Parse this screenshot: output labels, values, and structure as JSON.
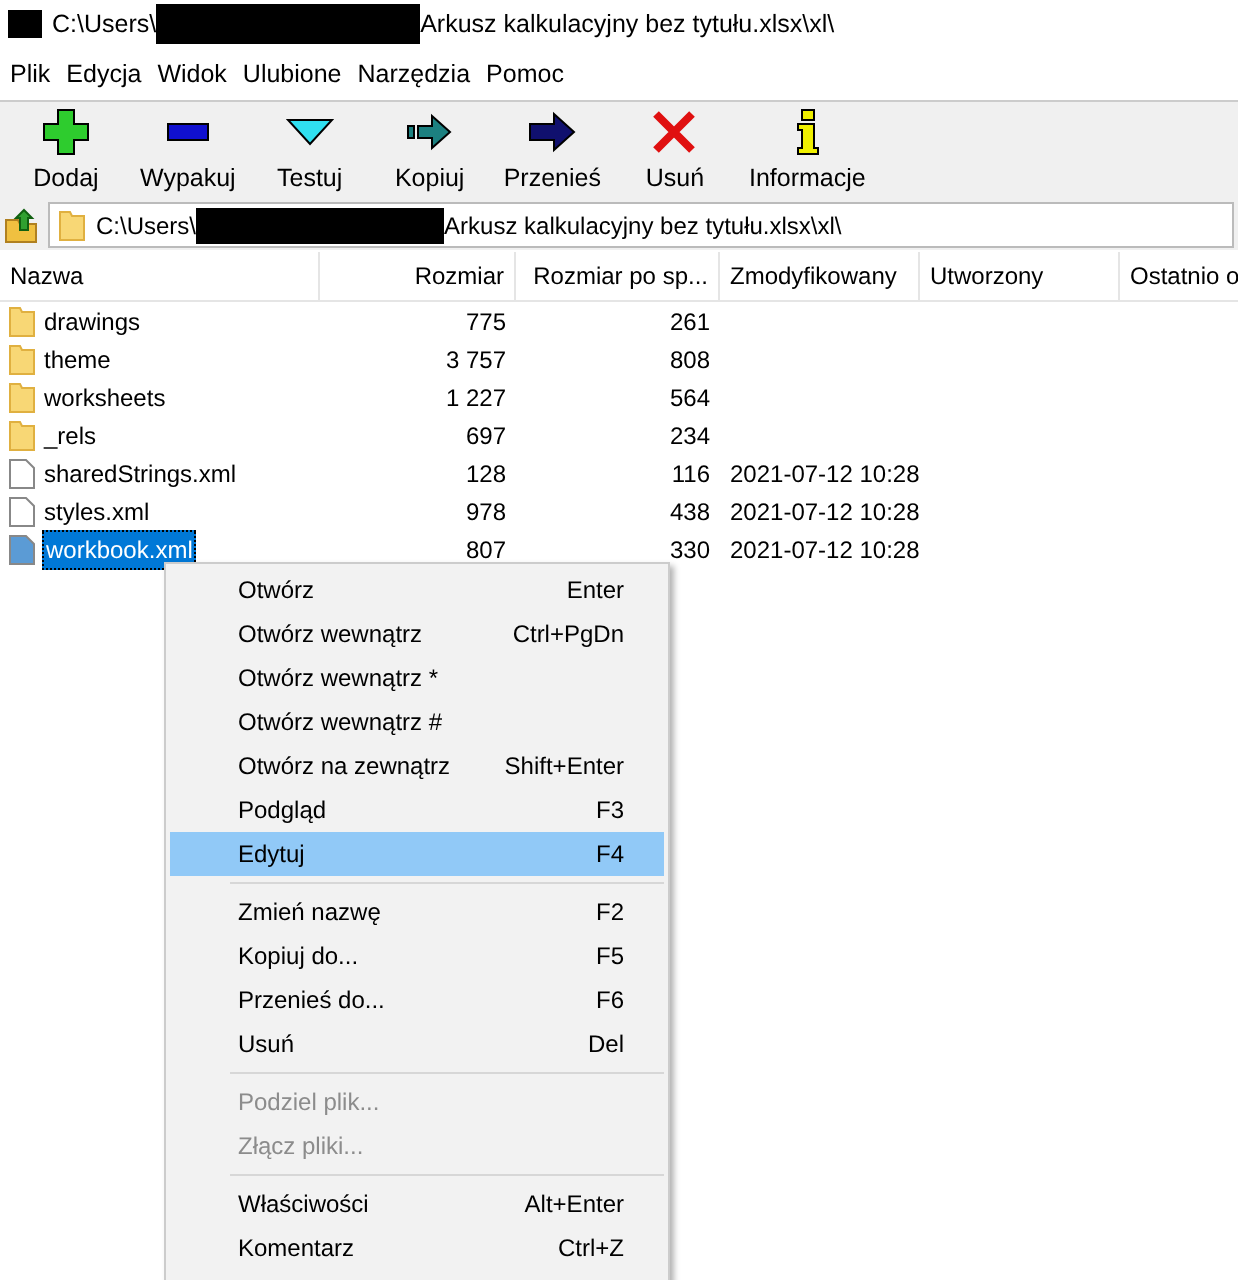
{
  "window": {
    "title_start": "C:\\Users\\",
    "title_end": "Arkusz kalkulacyjny bez tytułu.xlsx\\xl\\"
  },
  "menu_bar": [
    "Plik",
    "Edycja",
    "Widok",
    "Ulubione",
    "Narzędzia",
    "Pomoc"
  ],
  "toolbar": [
    {
      "label": "Dodaj",
      "kind": "add"
    },
    {
      "label": "Wypakuj",
      "kind": "extract"
    },
    {
      "label": "Testuj",
      "kind": "test"
    },
    {
      "label": "Kopiuj",
      "kind": "copy"
    },
    {
      "label": "Przenieś",
      "kind": "move"
    },
    {
      "label": "Usuń",
      "kind": "delete"
    },
    {
      "label": "Informacje",
      "kind": "info"
    }
  ],
  "address": {
    "start": "C:\\Users\\",
    "end": "Arkusz kalkulacyjny bez tytułu.xlsx\\xl\\"
  },
  "table": {
    "columns": [
      "Nazwa",
      "Rozmiar",
      "Rozmiar po sp...",
      "Zmodyfikowany",
      "Utworzony",
      "Ostatnio o"
    ],
    "rows": [
      {
        "name": "drawings",
        "kind": "folder",
        "size": "775",
        "packed": "261",
        "modified": "",
        "selected": false
      },
      {
        "name": "theme",
        "kind": "folder",
        "size": "3 757",
        "packed": "808",
        "modified": "",
        "selected": false
      },
      {
        "name": "worksheets",
        "kind": "folder",
        "size": "1 227",
        "packed": "564",
        "modified": "",
        "selected": false
      },
      {
        "name": "_rels",
        "kind": "folder",
        "size": "697",
        "packed": "234",
        "modified": "",
        "selected": false
      },
      {
        "name": "sharedStrings.xml",
        "kind": "file",
        "size": "128",
        "packed": "116",
        "modified": "2021-07-12 10:28",
        "selected": false
      },
      {
        "name": "styles.xml",
        "kind": "file",
        "size": "978",
        "packed": "438",
        "modified": "2021-07-12 10:28",
        "selected": false
      },
      {
        "name": "workbook.xml",
        "kind": "file",
        "size": "807",
        "packed": "330",
        "modified": "2021-07-12 10:28",
        "selected": true
      }
    ]
  },
  "context_menu": [
    {
      "kind": "item",
      "label": "Otwórz",
      "shortcut": "Enter",
      "selected": false,
      "disabled": false
    },
    {
      "kind": "item",
      "label": "Otwórz wewnątrz",
      "shortcut": "Ctrl+PgDn",
      "selected": false,
      "disabled": false
    },
    {
      "kind": "item",
      "label": "Otwórz wewnątrz *",
      "selected": false,
      "disabled": false
    },
    {
      "kind": "item",
      "label": "Otwórz wewnątrz #",
      "selected": false,
      "disabled": false
    },
    {
      "kind": "item",
      "label": "Otwórz na zewnątrz",
      "shortcut": "Shift+Enter",
      "selected": false,
      "disabled": false
    },
    {
      "kind": "item",
      "label": "Podgląd",
      "shortcut": "F3",
      "selected": false,
      "disabled": false
    },
    {
      "kind": "item",
      "label": "Edytuj",
      "shortcut": "F4",
      "selected": true,
      "disabled": false
    },
    {
      "kind": "separator"
    },
    {
      "kind": "item",
      "label": "Zmień nazwę",
      "shortcut": "F2",
      "selected": false,
      "disabled": false
    },
    {
      "kind": "item",
      "label": "Kopiuj do...",
      "shortcut": "F5",
      "selected": false,
      "disabled": false
    },
    {
      "kind": "item",
      "label": "Przenieś do...",
      "shortcut": "F6",
      "selected": false,
      "disabled": false
    },
    {
      "kind": "item",
      "label": "Usuń",
      "shortcut": "Del",
      "selected": false,
      "disabled": false
    },
    {
      "kind": "separator"
    },
    {
      "kind": "item",
      "label": "Podziel plik...",
      "selected": false,
      "disabled": true
    },
    {
      "kind": "item",
      "label": "Złącz pliki...",
      "selected": false,
      "disabled": true
    },
    {
      "kind": "separator"
    },
    {
      "kind": "item",
      "label": "Właściwości",
      "shortcut": "Alt+Enter",
      "selected": false,
      "disabled": false
    },
    {
      "kind": "item",
      "label": "Komentarz",
      "shortcut": "Ctrl+Z",
      "selected": false,
      "disabled": false
    }
  ]
}
